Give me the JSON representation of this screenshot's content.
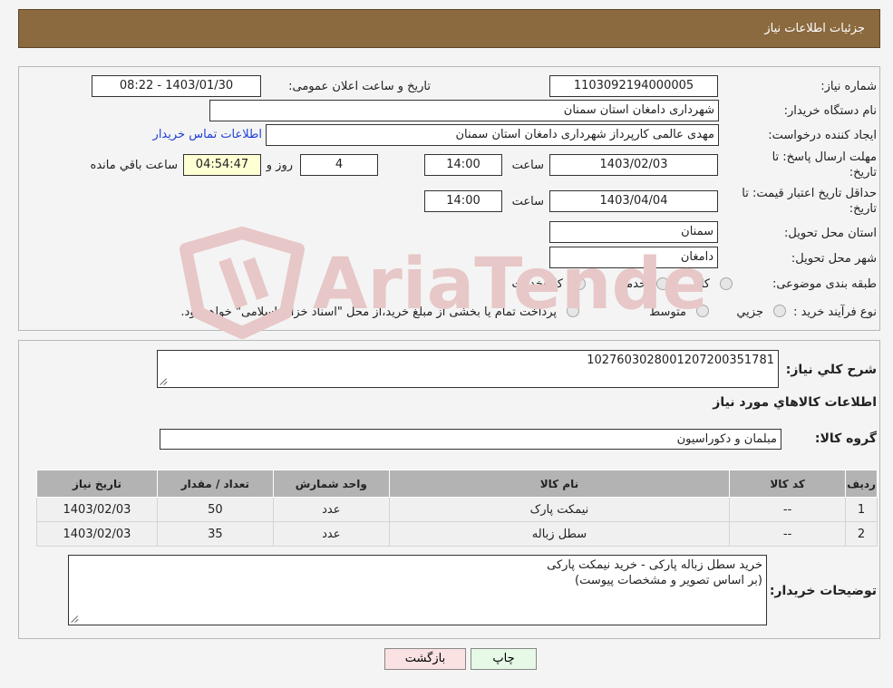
{
  "header": {
    "title": "جزئیات اطلاعات نیاز"
  },
  "form": {
    "need_number_label": "شماره نیاز:",
    "need_number": "1103092194000005",
    "announce_label": "تاریخ و ساعت اعلان عمومی:",
    "announce_value": "1403/01/30 - 08:22",
    "buyer_org_label": "نام دستگاه خریدار:",
    "buyer_org": "شهرداری دامغان استان سمنان",
    "requester_label": "ایجاد کننده درخواست:",
    "requester": "مهدی عالمی کارپرداز شهرداری دامغان استان سمنان",
    "contact_link": "اطلاعات تماس خریدار",
    "deadline_label_1": "مهلت ارسال پاسخ: تا",
    "deadline_label_2": "تاریخ:",
    "deadline_date": "1403/02/03",
    "time_label": "ساعت",
    "deadline_time": "14:00",
    "days_value": "4",
    "days_label": "روز و",
    "remaining_time": "04:54:47",
    "remaining_label": "ساعت باقي مانده",
    "validity_label_1": "حداقل تاریخ اعتبار قیمت: تا",
    "validity_label_2": "تاریخ:",
    "validity_date": "1403/04/04",
    "validity_time": "14:00",
    "province_label": "استان محل تحویل:",
    "province": "سمنان",
    "city_label": "شهر محل تحویل:",
    "city": "دامغان",
    "category_label": "طبقه بندی موضوعی:",
    "category_options": [
      "کالا",
      "خدمت",
      "کالا/خدمت"
    ],
    "process_label": "نوع فرآیند خرید :",
    "process_options": [
      "جزيي",
      "متوسط"
    ],
    "process_note": "پرداخت تمام یا بخشی از مبلغ خرید،از محل \"اسناد خزانه اسلامی\" خواهد بود."
  },
  "details": {
    "summary_label": "شرح کلي نياز:",
    "summary_value": "1027603028001207200351781",
    "goods_info_title": "اطلاعات کالاهاي مورد نياز",
    "goods_group_label": "گروه کالا:",
    "goods_group_value": "مبلمان و دکوراسیون",
    "table": {
      "headers": [
        "رديف",
        "کد کالا",
        "نام کالا",
        "واحد شمارش",
        "تعداد / مقدار",
        "تاريخ نياز"
      ],
      "rows": [
        [
          "1",
          "--",
          "نیمکت پارک",
          "عدد",
          "50",
          "1403/02/03"
        ],
        [
          "2",
          "--",
          "سطل زباله",
          "عدد",
          "35",
          "1403/02/03"
        ]
      ]
    },
    "buyer_desc_label": "توضیحات خریدار:",
    "buyer_desc_line1": "خرید سطل زباله پارکی - خرید نیمکت پارکی",
    "buyer_desc_line2": "(بر اساس تصویر و مشخصات پیوست)"
  },
  "buttons": {
    "print": "چاپ",
    "back": "بازگشت"
  },
  "watermark": "AriaTender.neT",
  "colors": {
    "header_bg": "#8b6a3f",
    "link": "#1f3fd8",
    "remaining_bg": "#ffffd4",
    "print_bg": "#e6f8e6",
    "back_bg": "#fbe2e2",
    "watermark": "#e7c7c7"
  }
}
